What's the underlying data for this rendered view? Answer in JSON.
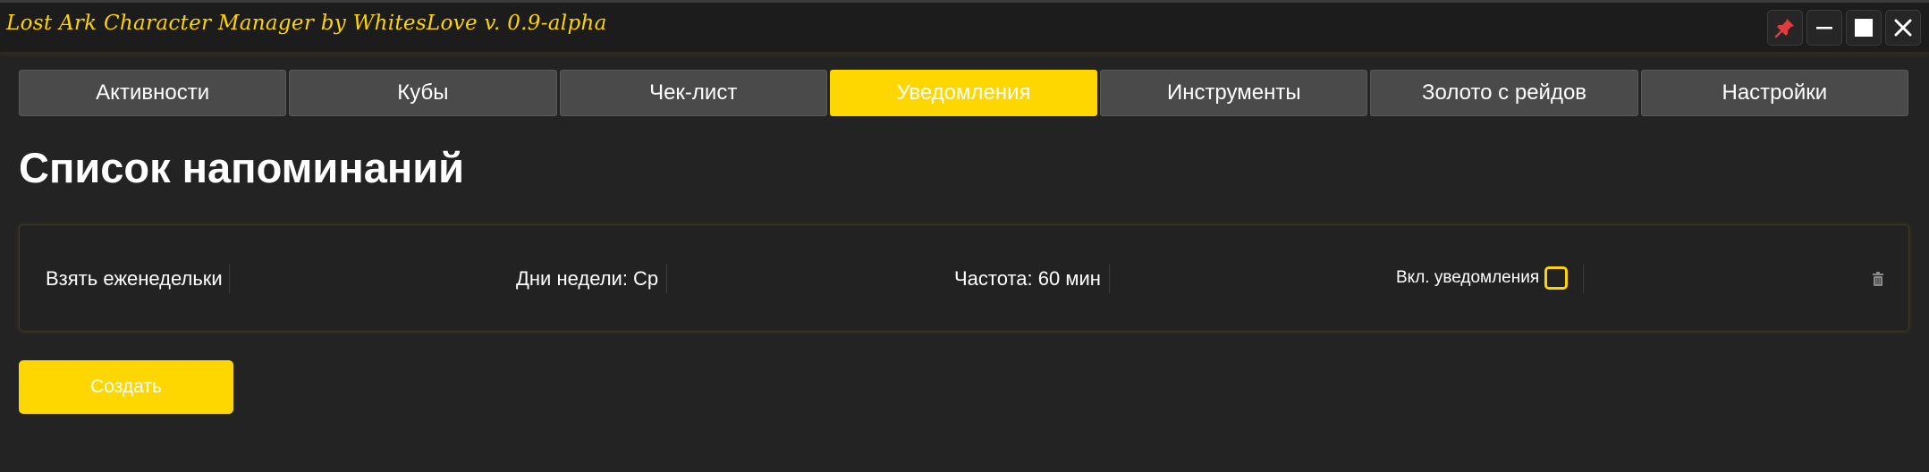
{
  "window": {
    "title": "Lost Ark Character Manager by WhitesLove v. 0.9-alpha",
    "buttons": [
      "pin-icon",
      "minimize-icon",
      "maximize-icon",
      "close-icon"
    ]
  },
  "tabs": [
    {
      "label": "Активности",
      "active": false
    },
    {
      "label": "Кубы",
      "active": false
    },
    {
      "label": "Чек-лист",
      "active": false
    },
    {
      "label": "Уведомления",
      "active": true
    },
    {
      "label": "Инструменты",
      "active": false
    },
    {
      "label": "Золото с рейдов",
      "active": false
    },
    {
      "label": "Настройки",
      "active": false
    }
  ],
  "page": {
    "title": "Список напоминаний"
  },
  "reminders": [
    {
      "name": "Взять еженедельки",
      "days": "Дни недели: Ср",
      "frequency": "Частота: 60 мин",
      "notify_label": "Вкл. уведомления",
      "notify_enabled": false
    }
  ],
  "actions": {
    "create_label": "Создать"
  },
  "colors": {
    "accent": "#ffd700",
    "background": "#232323",
    "tab": "#4a4a4a",
    "title": "#ffd400"
  }
}
